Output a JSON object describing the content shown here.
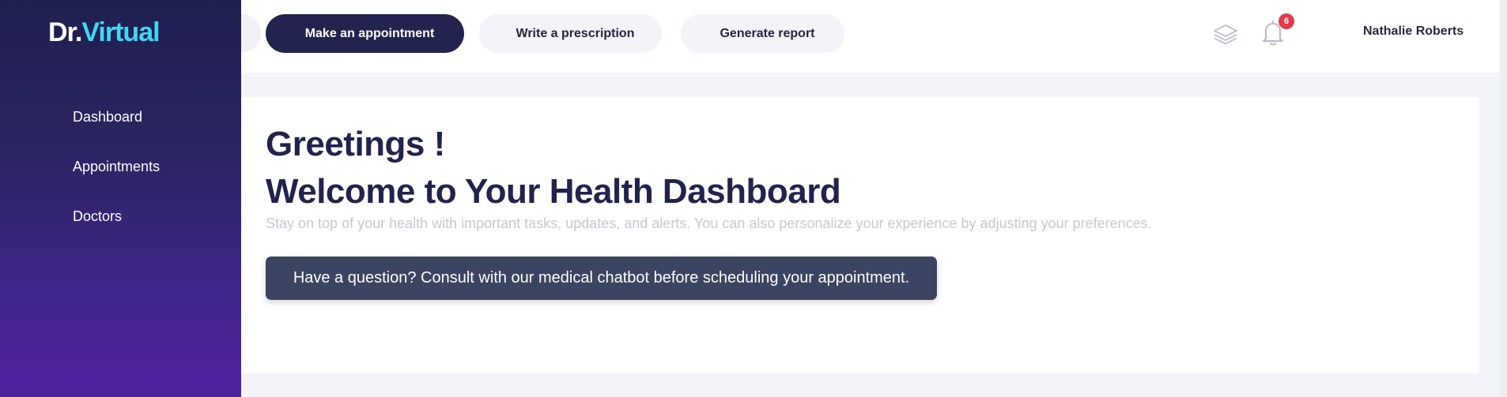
{
  "logo": {
    "part1": "Dr.",
    "part2": "Virtual"
  },
  "sidebar": {
    "items": [
      {
        "label": "Dashboard"
      },
      {
        "label": "Appointments"
      },
      {
        "label": "Doctors"
      }
    ]
  },
  "header": {
    "actions": [
      {
        "label": "Make an appointment"
      },
      {
        "label": "Write a prescription"
      },
      {
        "label": "Generate report"
      }
    ],
    "notification_count": "6",
    "user_name": "Nathalie Roberts",
    "icons": [
      "layers-icon",
      "bell-icon"
    ]
  },
  "main": {
    "greeting": "Greetings !",
    "title": "Welcome to Your Health Dashboard",
    "subtitle": "Stay on top of your health with important tasks, updates, and alerts. You can also personalize your experience by adjusting your preferences.",
    "chatbot_button": "Have a question? Consult with our medical chatbot before scheduling your appointment."
  },
  "colors": {
    "sidebar_top": "#1f1f4f",
    "sidebar_bottom": "#4e229f",
    "accent_cyan": "#3fd7f5",
    "primary_dark": "#23234f",
    "badge_red": "#e23a4e",
    "chat_button": "#3b4460"
  }
}
